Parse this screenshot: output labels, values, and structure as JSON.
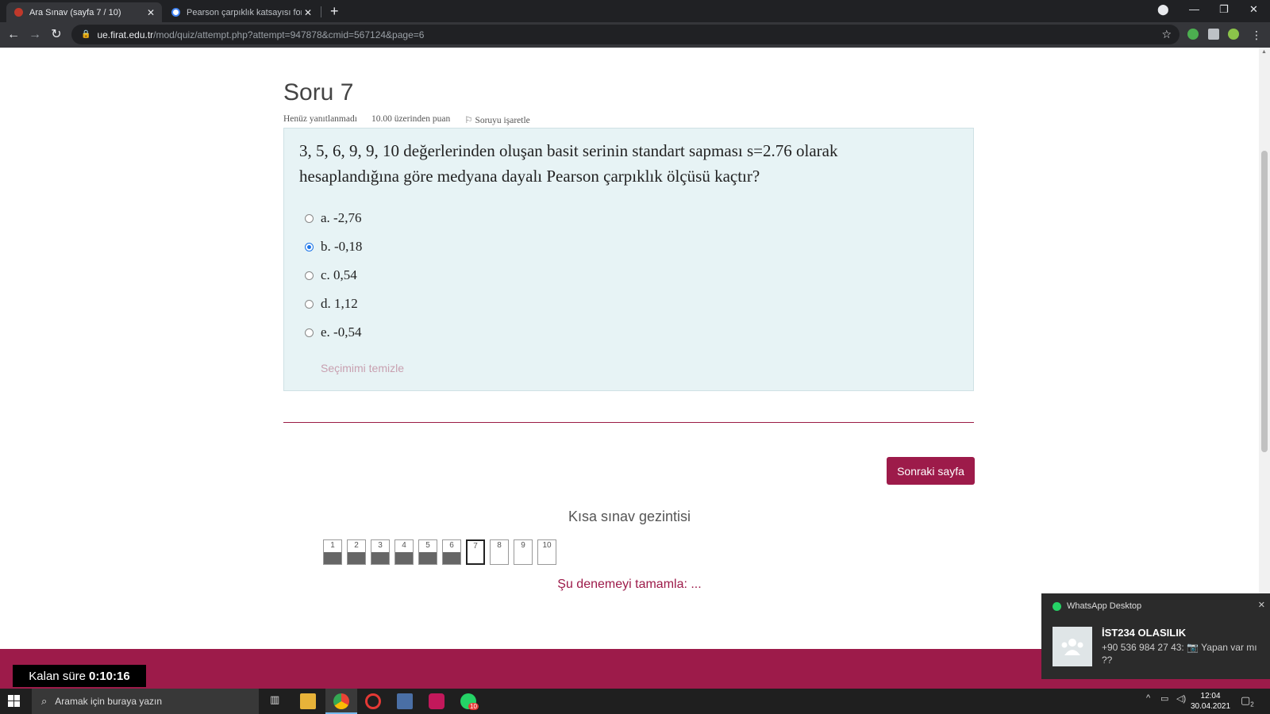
{
  "browser": {
    "tabs": [
      {
        "title": "Ara Sınav (sayfa 7 / 10)",
        "active": true
      },
      {
        "title": "Pearson çarpıklık katsayısı formülü",
        "active": false
      }
    ],
    "url_host": "ue.firat.edu.tr",
    "url_path": "/mod/quiz/attempt.php?attempt=947878&cmid=567124&page=6",
    "new_tab": "+",
    "close_tab": "✕"
  },
  "question": {
    "heading": "Soru 7",
    "status": "Henüz yanıtlanmadı",
    "points": "10.00 üzerinden puan",
    "flag_label": "Soruyu işaretle",
    "text": "3, 5, 6, 9, 9, 10 değerlerinden oluşan basit serinin standart sapması s=2.76 olarak hesaplandığına göre medyana dayalı Pearson çarpıklık ölçüsü kaçtır?",
    "options": [
      {
        "label": "a. -2,76",
        "checked": false
      },
      {
        "label": "b. -0,18",
        "checked": true
      },
      {
        "label": "c. 0,54",
        "checked": false
      },
      {
        "label": "d. 1,12",
        "checked": false
      },
      {
        "label": "e. -0,54",
        "checked": false
      }
    ],
    "clear_selection": "Seçimimi temizle"
  },
  "actions": {
    "next_page": "Sonraki sayfa"
  },
  "quiz_nav": {
    "title": "Kısa sınav gezintisi",
    "buttons": [
      "1",
      "2",
      "3",
      "4",
      "5",
      "6",
      "7",
      "8",
      "9",
      "10"
    ],
    "answered_count": 6,
    "current": "7",
    "finish": "Şu denemeyi tamamla: ..."
  },
  "timer": {
    "label": "Kalan süre",
    "value": "0:10:16"
  },
  "notification": {
    "app": "WhatsApp Desktop",
    "group": "İST234 OLASILIK",
    "message": "+90 536 984 27 43: 📷 Yapan var mı ??"
  },
  "taskbar": {
    "search_placeholder": "Aramak için buraya yazın",
    "time": "12:04",
    "date": "30.04.2021",
    "notification_count": "2",
    "whatsapp_badge": "10"
  },
  "colors": {
    "accent": "#9d1b4a",
    "question_bg": "#e7f3f5"
  }
}
